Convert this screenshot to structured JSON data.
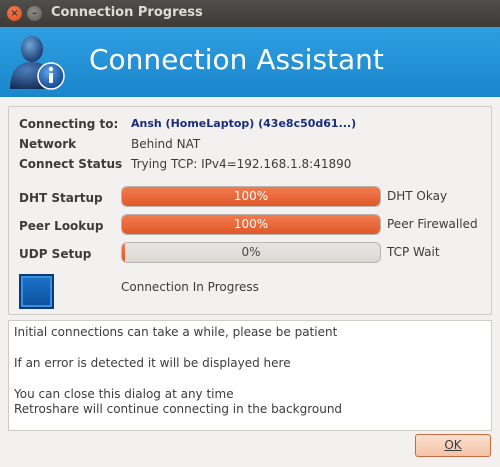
{
  "window": {
    "title": "Connection Progress"
  },
  "header": {
    "title": "Connection Assistant"
  },
  "info": {
    "connecting_to_label": "Connecting to:",
    "connecting_to_value": "Ansh (HomeLaptop) (43e8c50d61...)",
    "network_label": "Network",
    "network_value": "Behind NAT",
    "connect_status_label": "Connect Status",
    "connect_status_value": "Trying TCP: IPv4=192.168.1.8:41890"
  },
  "progress": [
    {
      "label": "DHT Startup",
      "percent_text": "100%",
      "fraction": 1.0,
      "status": "DHT Okay"
    },
    {
      "label": "Peer Lookup",
      "percent_text": "100%",
      "fraction": 1.0,
      "status": "Peer Firewalled"
    },
    {
      "label": "UDP Setup",
      "percent_text": "0%",
      "fraction": 0.0,
      "status": "TCP Wait"
    }
  ],
  "connection_state": "Connection In Progress",
  "messages": {
    "line1": "Initial connections can take a while, please be patient",
    "line2": "If an error is detected it will be displayed here",
    "line3": "You can close this dialog at any time",
    "line4": "Retroshare will continue connecting in the background"
  },
  "ok_button": {
    "label": "OK"
  },
  "colors": {
    "accent": "#e95f2f",
    "banner": "#1f90d6",
    "titlebar": "#3c3b37"
  },
  "icons": [
    "close-icon",
    "minimize-icon",
    "user-info-icon"
  ]
}
